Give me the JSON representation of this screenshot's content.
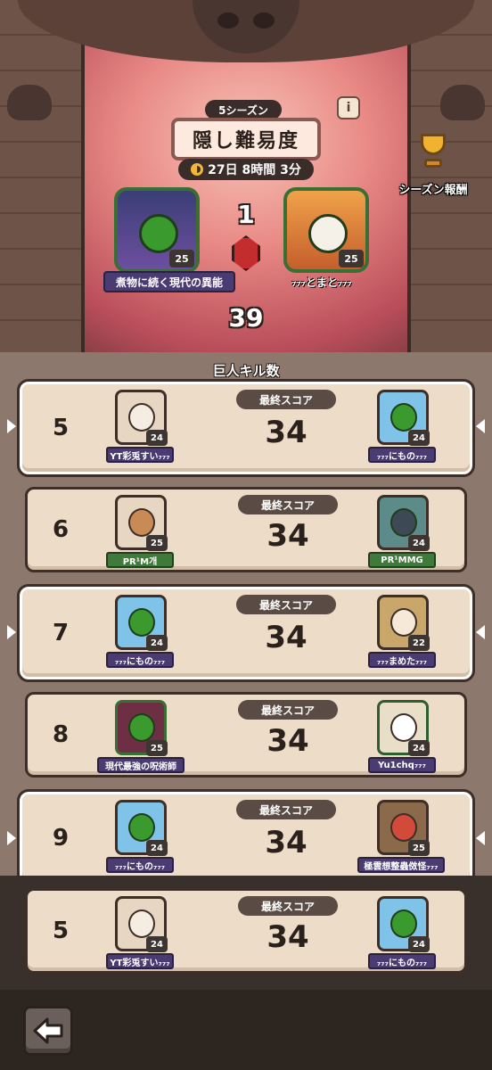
{
  "header": {
    "season": "5シーズン",
    "title": "隠し難易度",
    "timer": "27日 8時間 3分",
    "info_label": "i",
    "reward_label": "シーズン報酬",
    "rank": "1",
    "total_score": "39",
    "left_player": {
      "name": "煮物に続く現代の異能",
      "level": "25"
    },
    "right_player": {
      "name": "₇₇₇とまと₇₇₇",
      "level": "25"
    }
  },
  "list": {
    "title": "巨人キル数",
    "score_label": "最終スコア",
    "rows": [
      {
        "rank": "5",
        "score": "34",
        "p1": {
          "name": "YT彩兎すい₇₇₇",
          "level": "24"
        },
        "p2": {
          "name": "₇₇₇にもの₇₇₇",
          "level": "24"
        }
      },
      {
        "rank": "6",
        "score": "34",
        "p1": {
          "name": "PR¹M개",
          "level": "25"
        },
        "p2": {
          "name": "PR¹MMG",
          "level": "24"
        }
      },
      {
        "rank": "7",
        "score": "34",
        "p1": {
          "name": "₇₇₇にもの₇₇₇",
          "level": "24"
        },
        "p2": {
          "name": "₇₇₇まめた₇₇₇",
          "level": "22"
        }
      },
      {
        "rank": "8",
        "score": "34",
        "p1": {
          "name": "現代最強の呪術師",
          "level": "25"
        },
        "p2": {
          "name": "Yu1chq₇₇₇",
          "level": "24"
        }
      },
      {
        "rank": "9",
        "score": "34",
        "p1": {
          "name": "₇₇₇にもの₇₇₇",
          "level": "24"
        },
        "p2": {
          "name": "極雲想整蟲傚怪₇₇₇",
          "level": "25"
        }
      }
    ],
    "my_row": {
      "rank": "5",
      "score": "34",
      "p1": {
        "name": "YT彩兎すい₇₇₇",
        "level": "24"
      },
      "p2": {
        "name": "₇₇₇にもの₇₇₇",
        "level": "24"
      }
    }
  },
  "colors": {
    "accent": "#4a3b73",
    "card": "#ecdcc8",
    "panel": "#8c786d"
  }
}
